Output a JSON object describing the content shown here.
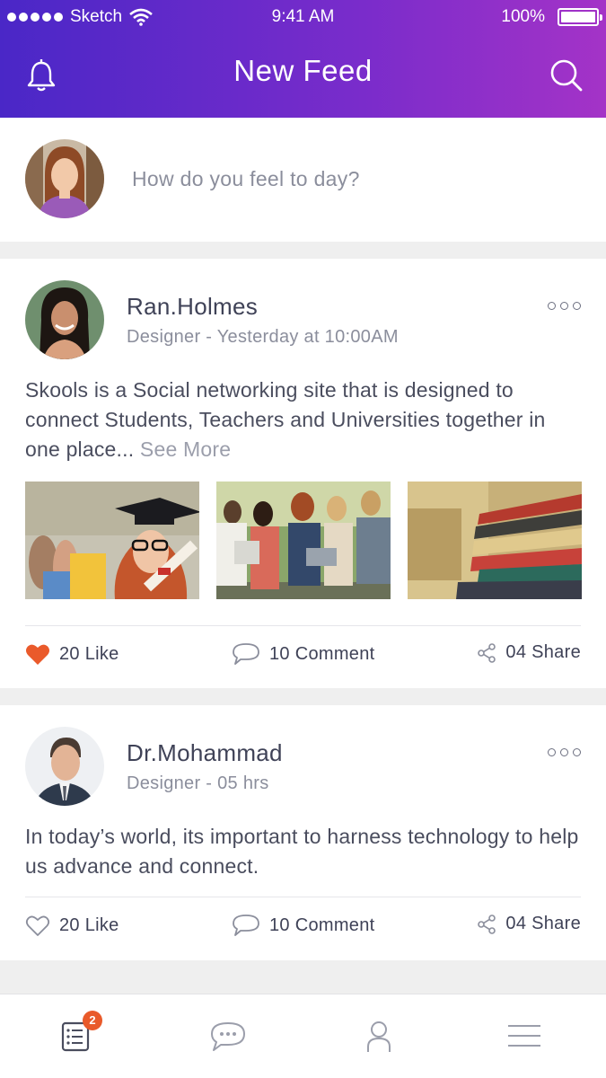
{
  "status_bar": {
    "carrier": "Sketch",
    "time": "9:41 AM",
    "battery": "100%",
    "battery_level": 1.0
  },
  "header": {
    "title": "New Feed",
    "left_icon": "bell-icon",
    "right_icon": "search-icon"
  },
  "composer": {
    "placeholder": "How do you feel to day?"
  },
  "posts": [
    {
      "author": "Ran.Holmes",
      "meta": "Designer - Yesterday at 10:00AM",
      "text": "Skools is a Social networking site that is designed to connect Students, Teachers and Universities together in one place...",
      "see_more": "See More",
      "photos": [
        "graduate-photo",
        "students-photo",
        "books-photo"
      ],
      "like_label": "20 Like",
      "liked": true,
      "comment_label": "10 Comment",
      "share_label": "04 Share"
    },
    {
      "author": "Dr.Mohammad",
      "meta": "Designer - 05 hrs",
      "text": "In today’s world, its important to harness technology to help us advance and connect.",
      "like_label": "20 Like",
      "liked": false,
      "comment_label": "10 Comment",
      "share_label": "04 Share"
    }
  ],
  "tabbar": {
    "items": [
      {
        "icon": "feed-list-icon",
        "badge": "2"
      },
      {
        "icon": "chat-icon"
      },
      {
        "icon": "profile-icon"
      },
      {
        "icon": "menu-icon"
      }
    ]
  },
  "colors": {
    "gradient_start": "#4a27c7",
    "gradient_end": "#a433c7",
    "like_red": "#ea5a2b",
    "badge": "#e95a2a"
  }
}
